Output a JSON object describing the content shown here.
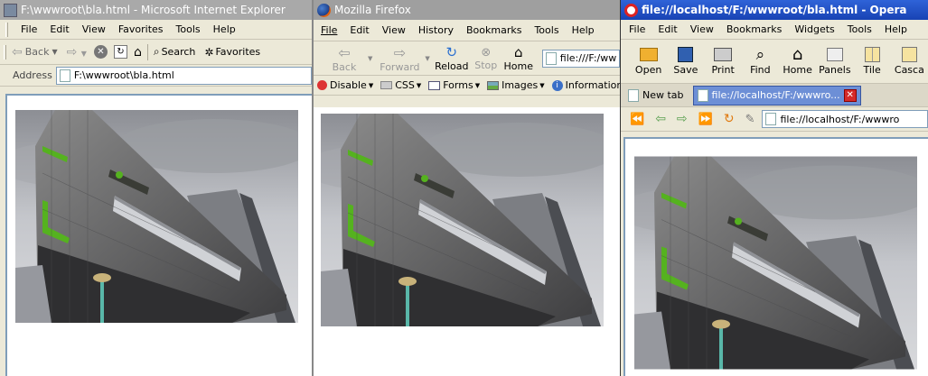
{
  "ie": {
    "title": "F:\\wwwroot\\bla.html - Microsoft Internet Explorer",
    "menu": [
      "File",
      "Edit",
      "View",
      "Favorites",
      "Tools",
      "Help"
    ],
    "back_label": "Back",
    "search_label": "Search",
    "favorites_label": "Favorites",
    "address_label": "Address",
    "address_value": "F:\\wwwroot\\bla.html",
    "title_bg": "#a9a9a9"
  },
  "firefox": {
    "title": "Mozilla Firefox",
    "menu": [
      "File",
      "Edit",
      "View",
      "History",
      "Bookmarks",
      "Tools",
      "Help"
    ],
    "nav": [
      "Back",
      "Forward",
      "Reload",
      "Stop",
      "Home"
    ],
    "url": "file:///F:/ww",
    "devbar": [
      "Disable",
      "CSS",
      "Forms",
      "Images",
      "Information"
    ],
    "title_bg": "#9f9f9f"
  },
  "opera": {
    "title": "file://localhost/F:/wwwroot/bla.html - Opera",
    "menu": [
      "File",
      "Edit",
      "View",
      "Bookmarks",
      "Widgets",
      "Tools",
      "Help"
    ],
    "toolbar": [
      "Open",
      "Save",
      "Print",
      "Find",
      "Home",
      "Panels",
      "Tile",
      "Casca"
    ],
    "new_tab": "New tab",
    "active_tab": "file://localhost/F:/wwwro...",
    "address": "file://localhost/F:/wwwro",
    "title_bg": "#2152c8"
  },
  "colors": {
    "accent_green": "#55b21f",
    "sky": "#b9bcc2",
    "building": "#6f6f70"
  }
}
